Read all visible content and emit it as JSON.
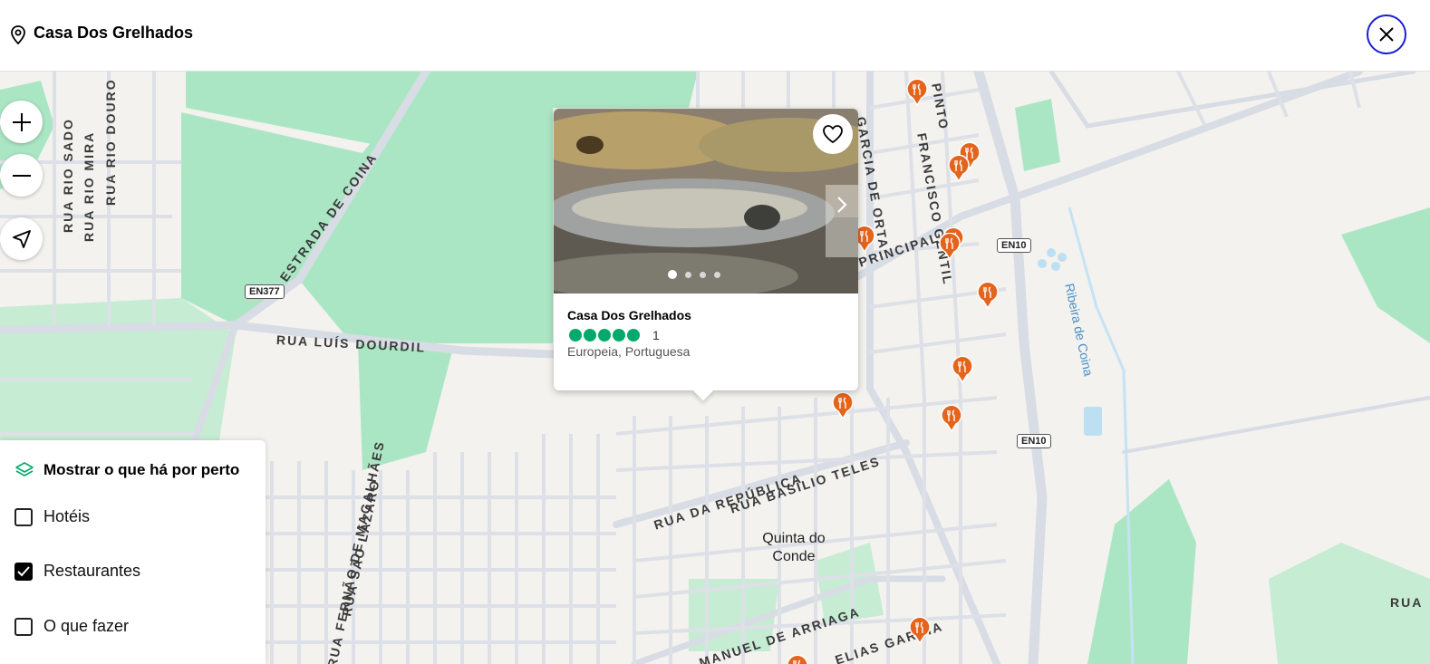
{
  "header": {
    "title": "Casa Dos Grelhados",
    "pin_icon": "location-pin-icon",
    "close_icon": "close-icon"
  },
  "map_controls": {
    "zoom_in_icon": "plus-icon",
    "zoom_out_icon": "minus-icon",
    "locate_icon": "navigate-arrow-icon"
  },
  "map": {
    "streets": [
      "RUA RIO SADO",
      "RUA RIO MIRA",
      "RUA RIO DOURO",
      "ESTRADA DE COINA",
      "RUA LUÍS DOURDIL",
      "RUA DA REPÚBLICA",
      "RUA BASÍLIO TELES",
      "RUA FERNÃO DE MAGALHÃES",
      "RUA SÃO LÁZARO",
      "MANUEL DE ARRIAGA",
      "ELIAS GARCIA",
      "PRINCIPAL",
      "GARCIA DE ORTA",
      "FRANCISCO GENTIL",
      "PINTO",
      "RUA"
    ],
    "places": {
      "town": "Quinta do Conde",
      "river": "Ribeira de Coina"
    },
    "shields": [
      "EN377",
      "EN10",
      "EN10"
    ],
    "colors": {
      "background": "#f3f2ee",
      "park": "#abe6c4",
      "road": "#d8dce4",
      "marker": "#e4641c",
      "rating": "#00aa6c",
      "close_border": "#1a1fd0"
    },
    "marker_icon": "restaurant-fork-knife-icon"
  },
  "popup": {
    "name": "Casa Dos Grelhados",
    "rating_bubbles": 5,
    "review_count": "1",
    "cuisine": "Europeia, Portuguesa",
    "favorite_icon": "heart-icon",
    "next_icon": "chevron-right-icon",
    "photo_index": 1,
    "photo_count": 4
  },
  "nearby": {
    "title": "Mostrar o que há por perto",
    "icon": "layers-icon",
    "options": [
      {
        "label": "Hotéis",
        "checked": false
      },
      {
        "label": "Restaurantes",
        "checked": true
      },
      {
        "label": "O que fazer",
        "checked": false
      }
    ]
  }
}
